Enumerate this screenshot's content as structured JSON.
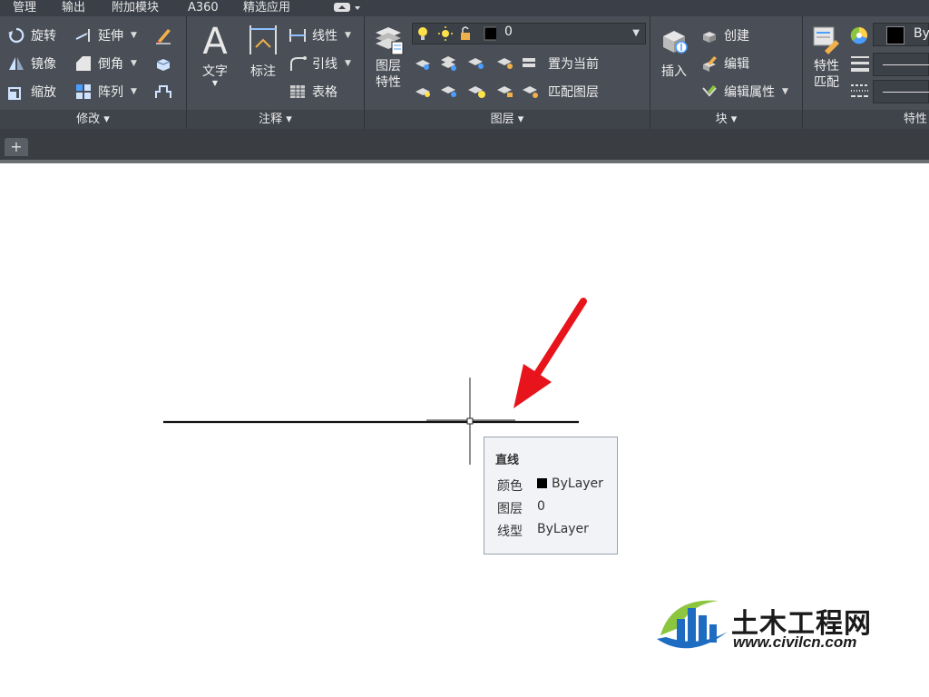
{
  "menubar": {
    "items": [
      "管理",
      "输出",
      "附加模块",
      "A360",
      "精选应用"
    ]
  },
  "ribbon": {
    "modify": {
      "title": "修改 ▾",
      "commands": [
        "旋转",
        "延伸",
        "镜像",
        "倒角",
        "缩放",
        "阵列"
      ]
    },
    "annotation": {
      "title": "注释 ▾",
      "text": "文字",
      "dimension": "标注",
      "linear": "线性",
      "leader": "引线",
      "table": "表格"
    },
    "layers": {
      "title": "图层 ▾",
      "properties_line1": "图层",
      "properties_line2": "特性",
      "current_layer": "0",
      "set_current": "置为当前",
      "match_layer": "匹配图层"
    },
    "block": {
      "title": "块 ▾",
      "insert": "插入",
      "create": "创建",
      "edit": "编辑",
      "edit_attributes": "编辑属性"
    },
    "properties": {
      "title": "特性",
      "match_line1": "特性",
      "match_line2": "匹配",
      "color_value": "By"
    }
  },
  "tooltip": {
    "title": "直线",
    "color_label": "颜色",
    "color_value": "ByLayer",
    "layer_label": "图层",
    "layer_value": "0",
    "linetype_label": "线型",
    "linetype_value": "ByLayer"
  },
  "watermark": {
    "name": "土木工程网",
    "url": "www.civilcn.com"
  },
  "colors": {
    "ribbon_bg": "#4a4f57",
    "menubar_bg": "#3b4048",
    "arrow": "#e8141b",
    "watermark_blue": "#1d6cc2",
    "watermark_green": "#8cc63e"
  }
}
